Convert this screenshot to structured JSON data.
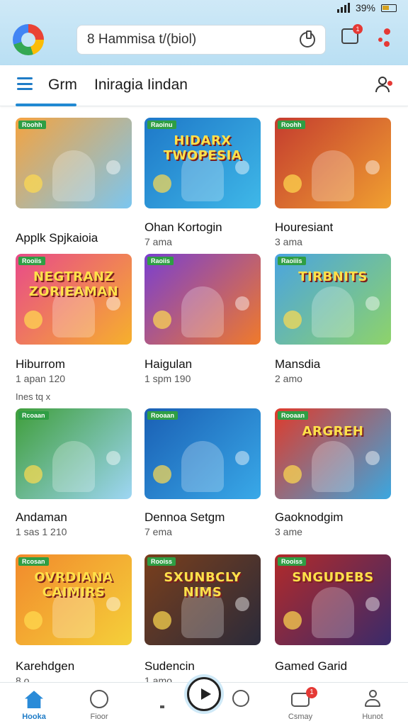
{
  "status_bar": {
    "battery_text": "39%"
  },
  "header": {
    "search_text": "8 Hammisa t/(biol)",
    "chat_badge": "1"
  },
  "tabs": {
    "active": "Grm",
    "second": "Iniragia Iindan"
  },
  "games": [
    {
      "title": "Applk Spjkaioia",
      "meta": "",
      "tag": "Roohh",
      "art_title": "",
      "colors": [
        "#f4a340",
        "#7bc6f0"
      ]
    },
    {
      "title": "Ohan Kortogin",
      "meta": "7 ama",
      "tag": "Raoinu",
      "art_title": "HIDARX TWOPESIA",
      "colors": [
        "#1e78c8",
        "#3fb8e8"
      ]
    },
    {
      "title": "Houresiant",
      "meta": "3 ama",
      "tag": "Roohh",
      "art_title": "",
      "colors": [
        "#c43c2f",
        "#f0a030"
      ]
    },
    {
      "title": "Hiburrom",
      "meta": "1 apan 120",
      "tag": "Rooiis",
      "art_title": "NEGTRANZ ZORIEAMAN",
      "colors": [
        "#e84a8a",
        "#f6b02c"
      ]
    },
    {
      "title": "Haigulan",
      "meta": "1 spm 190",
      "tag": "Raoiis",
      "art_title": "",
      "colors": [
        "#7a3fd0",
        "#f07a2a"
      ]
    },
    {
      "title": "Mansdia",
      "meta": "2 amo",
      "tag": "Raoiiis",
      "art_title": "TIRBNITS",
      "colors": [
        "#4aa4e0",
        "#8ed36a"
      ]
    },
    {
      "title": "Andaman",
      "meta": "1 sas 1 210",
      "tag": "Rcoaan",
      "art_title": "",
      "colors": [
        "#3f9e3a",
        "#9ed6f4"
      ]
    },
    {
      "title": "Dennoa Setgm",
      "meta": "7 ema",
      "tag": "Rooaan",
      "art_title": "",
      "colors": [
        "#1a5fb4",
        "#39a9e8"
      ]
    },
    {
      "title": "Gaoknodgim",
      "meta": "3 ame",
      "tag": "Rooaan",
      "art_title": "ARGREH",
      "colors": [
        "#e03a2a",
        "#3aa7e0"
      ]
    },
    {
      "title": "Karehdgen",
      "meta": "8 o",
      "tag": "Rcosan",
      "art_title": "OVRDIANA CAIMIRS",
      "colors": [
        "#f28a2c",
        "#f4d03a"
      ]
    },
    {
      "title": "Sudencin",
      "meta": "1 amo",
      "tag": "Rooiss",
      "art_title": "SXUNBCLY NIMS",
      "colors": [
        "#7a3f1c",
        "#2a2a3a"
      ]
    },
    {
      "title": "Gamed Garid",
      "meta": "",
      "tag": "Rooiss",
      "art_title": "SNGUDEBS",
      "colors": [
        "#b22a2a",
        "#3a2a6a"
      ]
    }
  ],
  "extra_line": "Ines  tq  x",
  "bottom_nav": [
    {
      "label": "Hooka",
      "icon": "home-icon"
    },
    {
      "label": "Fioor",
      "icon": "search-icon"
    },
    {
      "label": "",
      "icon": "play-icon"
    },
    {
      "label": "",
      "icon": "clock-icon"
    },
    {
      "label": "Csmay",
      "icon": "inbox-icon",
      "badge": "1"
    },
    {
      "label": "Hunot",
      "icon": "profile-icon"
    }
  ]
}
